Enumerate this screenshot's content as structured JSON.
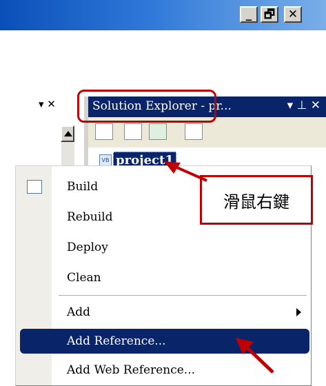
{
  "window": {
    "buttons": {
      "minimize": "_",
      "restore": "🗗",
      "close": "✕"
    }
  },
  "left_pane": {
    "controls": "▾ ✕"
  },
  "solution_explorer": {
    "title": "Solution Explorer - pr...",
    "controls": "▾ ⊥ ✕",
    "project": "project1",
    "project_icon": "VB"
  },
  "annotation": {
    "callout_text": "滑鼠右鍵",
    "color": "#c00000"
  },
  "context_menu": {
    "items": [
      {
        "label": "Build"
      },
      {
        "label": "Rebuild"
      },
      {
        "label": "Deploy"
      },
      {
        "label": "Clean"
      },
      {
        "label": "Add"
      },
      {
        "label": "Add Reference..."
      },
      {
        "label": "Add Web Reference..."
      }
    ],
    "selected": "Add Reference..."
  },
  "colors": {
    "title_active": "#0a246a",
    "menu_selected": "#0a246a",
    "annotation": "#c00000"
  }
}
